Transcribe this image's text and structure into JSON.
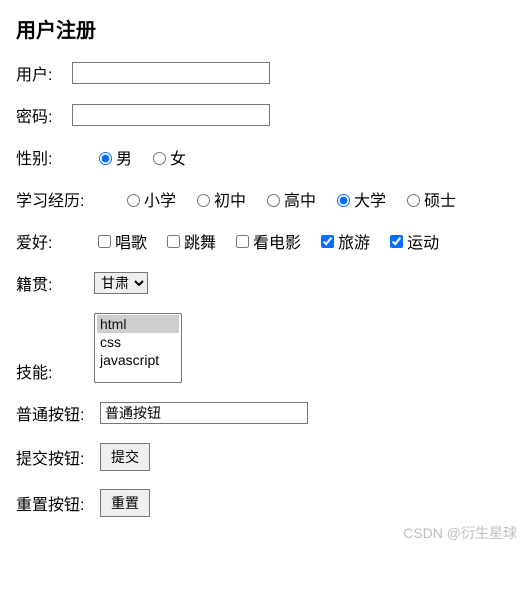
{
  "title": "用户注册",
  "user": {
    "label": "用户:",
    "value": ""
  },
  "password": {
    "label": "密码:",
    "value": ""
  },
  "gender": {
    "label": "性别:",
    "options": [
      {
        "label": "男",
        "checked": true
      },
      {
        "label": "女",
        "checked": false
      }
    ]
  },
  "education": {
    "label": "学习经历:",
    "options": [
      {
        "label": "小学",
        "checked": false
      },
      {
        "label": "初中",
        "checked": false
      },
      {
        "label": "高中",
        "checked": false
      },
      {
        "label": "大学",
        "checked": true
      },
      {
        "label": "硕士",
        "checked": false
      }
    ]
  },
  "hobby": {
    "label": "爱好:",
    "options": [
      {
        "label": "唱歌",
        "checked": false
      },
      {
        "label": "跳舞",
        "checked": false
      },
      {
        "label": "看电影",
        "checked": false
      },
      {
        "label": "旅游",
        "checked": true
      },
      {
        "label": "运动",
        "checked": true
      }
    ]
  },
  "origin": {
    "label": "籍贯:",
    "selected": "甘肃",
    "options": [
      "甘肃"
    ]
  },
  "skills": {
    "label": "技能:",
    "options": [
      {
        "label": "html",
        "selected": true
      },
      {
        "label": "css",
        "selected": false
      },
      {
        "label": "javascript",
        "selected": false
      }
    ]
  },
  "normal_button": {
    "label": "普通按钮:",
    "value": "普通按钮"
  },
  "submit_button": {
    "label": "提交按钮:",
    "text": "提交"
  },
  "reset_button": {
    "label": "重置按钮:",
    "text": "重置"
  },
  "watermark": "CSDN @衍生星球"
}
